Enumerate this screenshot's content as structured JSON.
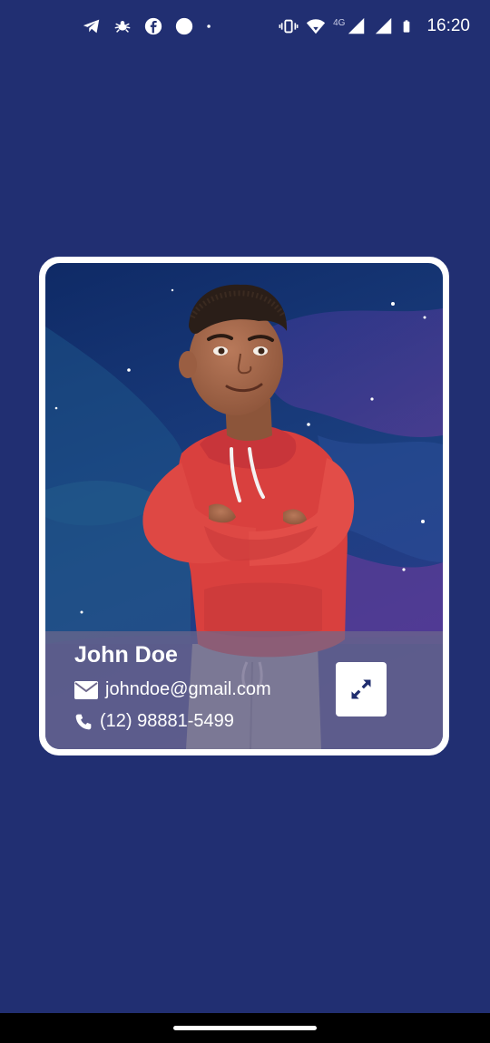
{
  "status_bar": {
    "time": "16:20",
    "network": "4G",
    "left_icons": [
      "telegram-icon",
      "bug-icon",
      "facebook-icon",
      "circle-icon",
      "dot-icon"
    ],
    "right_icons": [
      "vibrate-icon",
      "wifi-icon",
      "signal-icon",
      "signal-icon",
      "battery-icon"
    ]
  },
  "profile_card": {
    "name": "John Doe",
    "email": "johndoe@gmail.com",
    "phone": "(12) 98881-5499",
    "email_icon": "envelope-icon",
    "phone_icon": "phone-icon",
    "expand_icon": "expand-arrows-icon"
  },
  "colors": {
    "background": "#212f72",
    "card_border": "#ffffff",
    "info_panel": "#6e688c",
    "icon_accent": "#1f2d6e",
    "hoodie": "#d9403e"
  }
}
